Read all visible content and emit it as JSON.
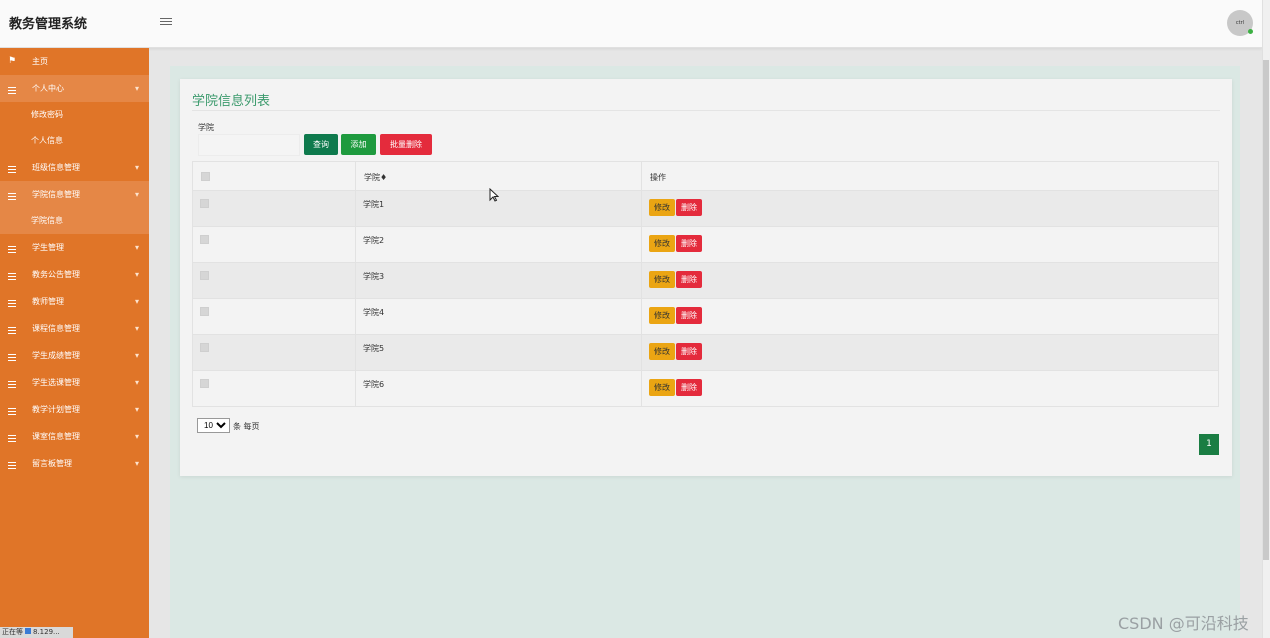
{
  "app": {
    "title": "教务管理系统",
    "avatar_label": "ctrl"
  },
  "sidebar": {
    "home": "主页",
    "items": [
      {
        "label": "个人中心",
        "open": true,
        "children": [
          "修改密码",
          "个人信息"
        ]
      },
      {
        "label": "班级信息管理"
      },
      {
        "label": "学院信息管理",
        "open": true,
        "children": [
          "学院信息"
        ]
      },
      {
        "label": "学生管理"
      },
      {
        "label": "教务公告管理"
      },
      {
        "label": "教师管理"
      },
      {
        "label": "课程信息管理"
      },
      {
        "label": "学生成绩管理"
      },
      {
        "label": "学生选课管理"
      },
      {
        "label": "教学计划管理"
      },
      {
        "label": "课室信息管理"
      },
      {
        "label": "留言板管理"
      }
    ],
    "arrow": "▾"
  },
  "panel": {
    "title": "学院信息列表",
    "filter_label": "学院",
    "filter_value": "",
    "query_btn": "查询",
    "add_btn": "添加",
    "batch_delete_btn": "批量删除"
  },
  "table": {
    "headers": [
      "",
      "学院♦",
      "操作"
    ],
    "rows": [
      "学院1",
      "学院2",
      "学院3",
      "学院4",
      "学院5",
      "学院6"
    ],
    "edit_label": "修改",
    "delete_label": "删除"
  },
  "pager": {
    "page_size": "10",
    "unit": "条 每页",
    "current_page": "1"
  },
  "status": {
    "left_text": "正在等",
    "ip_text": "8.129..."
  },
  "watermark": "CSDN @可沿科技",
  "colors": {
    "sidebar": "#e07528",
    "title": "#3b9a6c",
    "query": "#0e7a4d",
    "add": "#1e9a3e",
    "delete": "#e42b3c",
    "edit": "#eba513"
  }
}
